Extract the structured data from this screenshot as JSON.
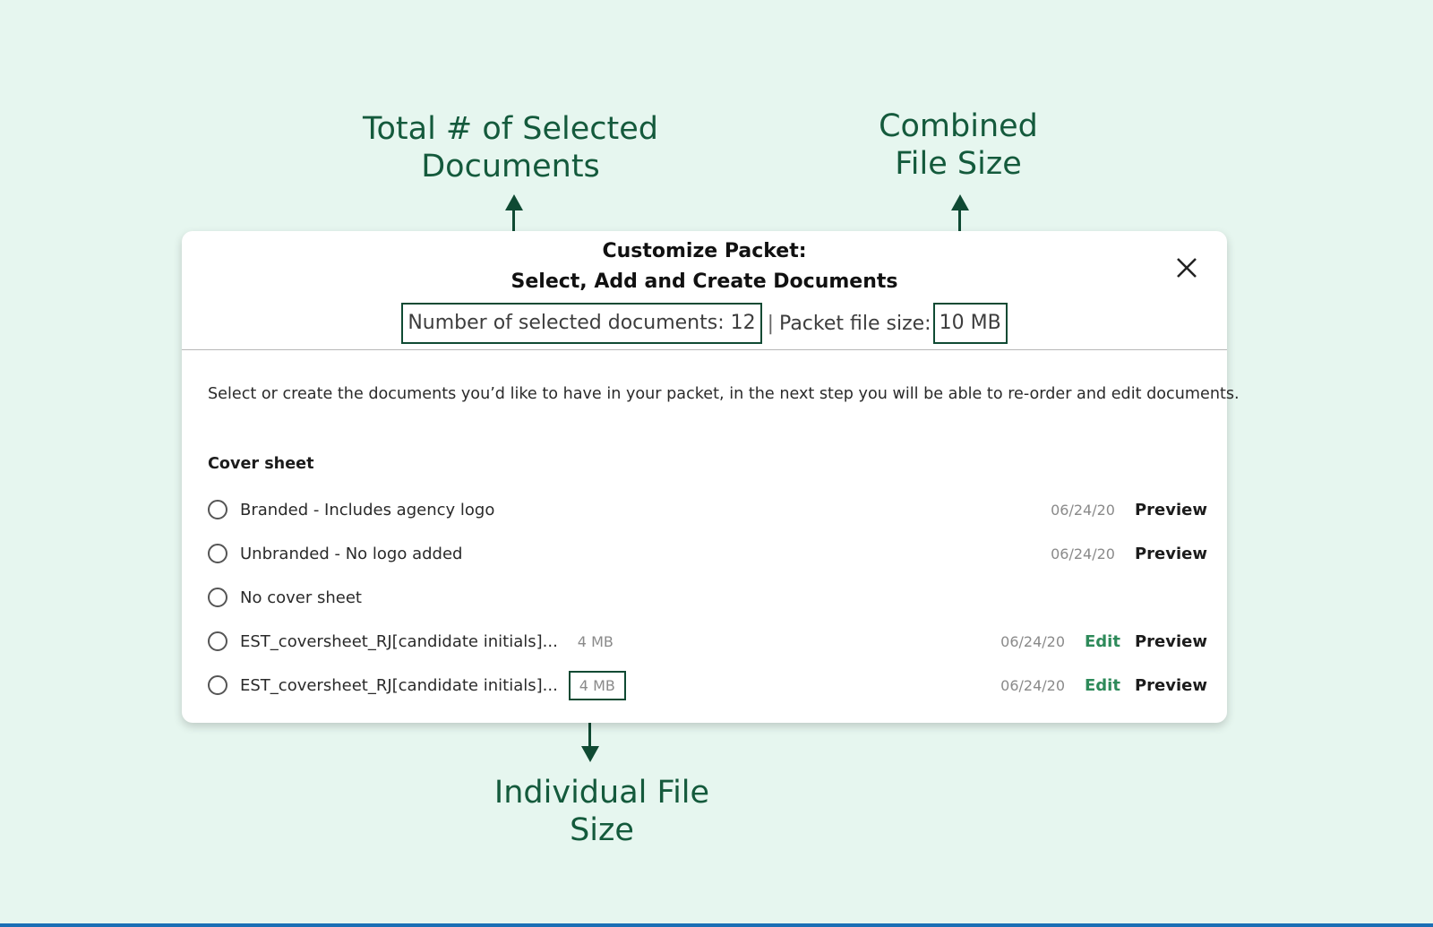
{
  "annotations": {
    "total_selected": "Total # of Selected\nDocuments",
    "combined_size": "Combined\nFile Size",
    "individual_size": "Individual File\nSize"
  },
  "modal": {
    "title_line1": "Customize Packet:",
    "title_line2": "Select, Add and Create Documents",
    "count_label": "Number of selected documents: 12",
    "separator": "|",
    "size_label": "Packet file size:",
    "size_value": "10 MB",
    "instructions": "Select or create the documents you’d like to have in your packet, in the next step you will be able to re-order and edit documents.",
    "section_title": "Cover sheet",
    "rows": [
      {
        "label": "Branded - Includes agency logo",
        "date": "06/24/20",
        "preview": "Preview"
      },
      {
        "label": "Unbranded - No logo added",
        "date": "06/24/20",
        "preview": "Preview"
      },
      {
        "label": "No cover sheet"
      },
      {
        "label": "EST_coversheet_RJ[candidate initials]...",
        "size": "4 MB",
        "date": "06/24/20",
        "edit": "Edit",
        "preview": "Preview"
      },
      {
        "label": "EST_coversheet_RJ[candidate initials]...",
        "size": "4 MB",
        "date": "06/24/20",
        "edit": "Edit",
        "preview": "Preview"
      }
    ]
  },
  "colors": {
    "background": "#e6f6ef",
    "annotation": "#145a3c",
    "accent_edit": "#2e8a5a"
  }
}
